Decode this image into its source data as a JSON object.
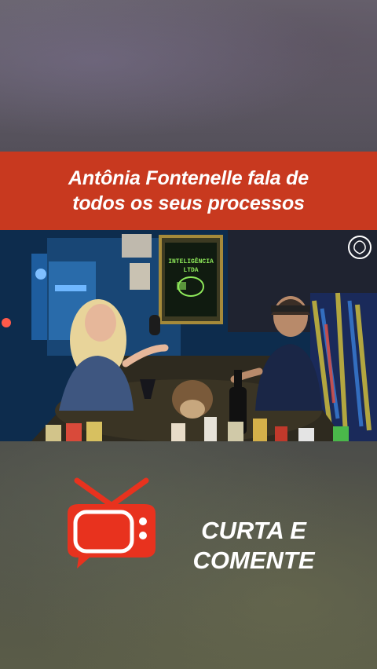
{
  "banner": {
    "title_line1": "Antônia Fontenelle fala de",
    "title_line2": "todos os seus processos"
  },
  "video": {
    "set_sign_line1": "INTELIGÊNCIA",
    "set_sign_line2": "LTDA"
  },
  "cta": {
    "line1": "CURTA E",
    "line2": "COMENTE"
  },
  "colors": {
    "banner_bg": "#c8391f",
    "logo_red": "#e8321e",
    "text": "#ffffff"
  },
  "icons": {
    "tv_logo": "tv-icon"
  }
}
